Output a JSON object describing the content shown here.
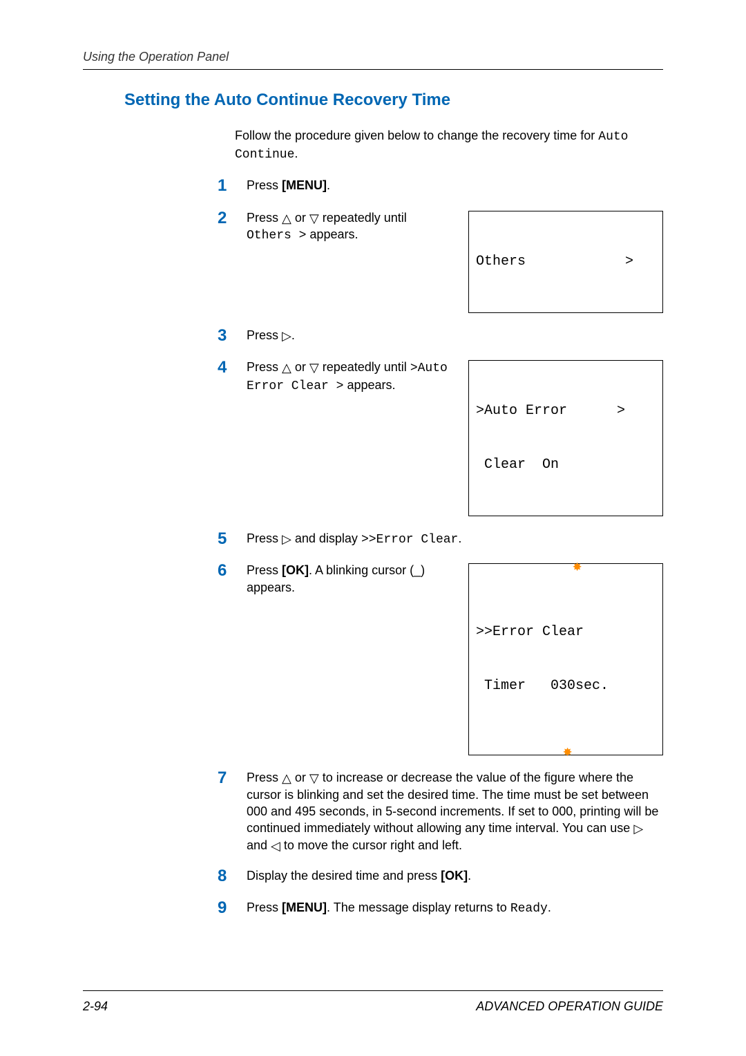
{
  "runningHead": "Using the Operation Panel",
  "sectionTitle": "Setting the Auto Continue Recovery Time",
  "intro": {
    "prefix": "Follow the procedure given below to change the recovery time for ",
    "monoA": "Auto Continue",
    "period": "."
  },
  "steps": {
    "s1": {
      "num": "1",
      "t1": "Press ",
      "b1": "[MENU]",
      "t2": "."
    },
    "s2": {
      "num": "2",
      "t1": "Press ",
      "tri1": "△",
      "t2": " or ",
      "tri2": "▽",
      "t3": " repeatedly until ",
      "m1": "Others  >",
      "t4": " appears.",
      "lcd": "Others            >"
    },
    "s3": {
      "num": "3",
      "t1": "Press ",
      "tri1": "▷",
      "t2": "."
    },
    "s4": {
      "num": "4",
      "t1": "Press ",
      "tri1": "△",
      "t2": " or ",
      "tri2": "▽",
      "t3": " repeatedly until ",
      "m1": ">Auto Error Clear   >",
      "t4": " appears.",
      "lcdL1": ">Auto Error      >",
      "lcdL2": " Clear  On"
    },
    "s5": {
      "num": "5",
      "t1": "Press ",
      "tri1": "▷",
      "t2": " and display ",
      "m1": ">>Error Clear",
      "t3": "."
    },
    "s6": {
      "num": "6",
      "t1": "Press ",
      "b1": "[OK]",
      "t2": ". A blinking cursor (_) appears.",
      "lcdL1": ">>Error Clear",
      "lcdL2": " Timer   030sec.",
      "star": "✸"
    },
    "s7": {
      "num": "7",
      "t1": "Press ",
      "tri1": "△",
      "t2": " or ",
      "tri2": "▽",
      "t3": " to increase or decrease the value of the figure where the cursor is blinking and set the desired time. The time must be set between 000 and 495 seconds, in 5-second increments. If set to 000, printing will be continued immediately without allowing any time interval. You can use ",
      "tri3": "▷",
      "t4": " and ",
      "tri4": "◁",
      "t5": " to move the cursor right and left."
    },
    "s8": {
      "num": "8",
      "t1": "Display the desired time and press ",
      "b1": "[OK]",
      "t2": "."
    },
    "s9": {
      "num": "9",
      "t1": "Press ",
      "b1": "[MENU]",
      "t2": ". The message display returns to ",
      "m1": "Ready",
      "t3": "."
    }
  },
  "footer": {
    "pageNum": "2-94",
    "guide": "ADVANCED OPERATION GUIDE"
  }
}
